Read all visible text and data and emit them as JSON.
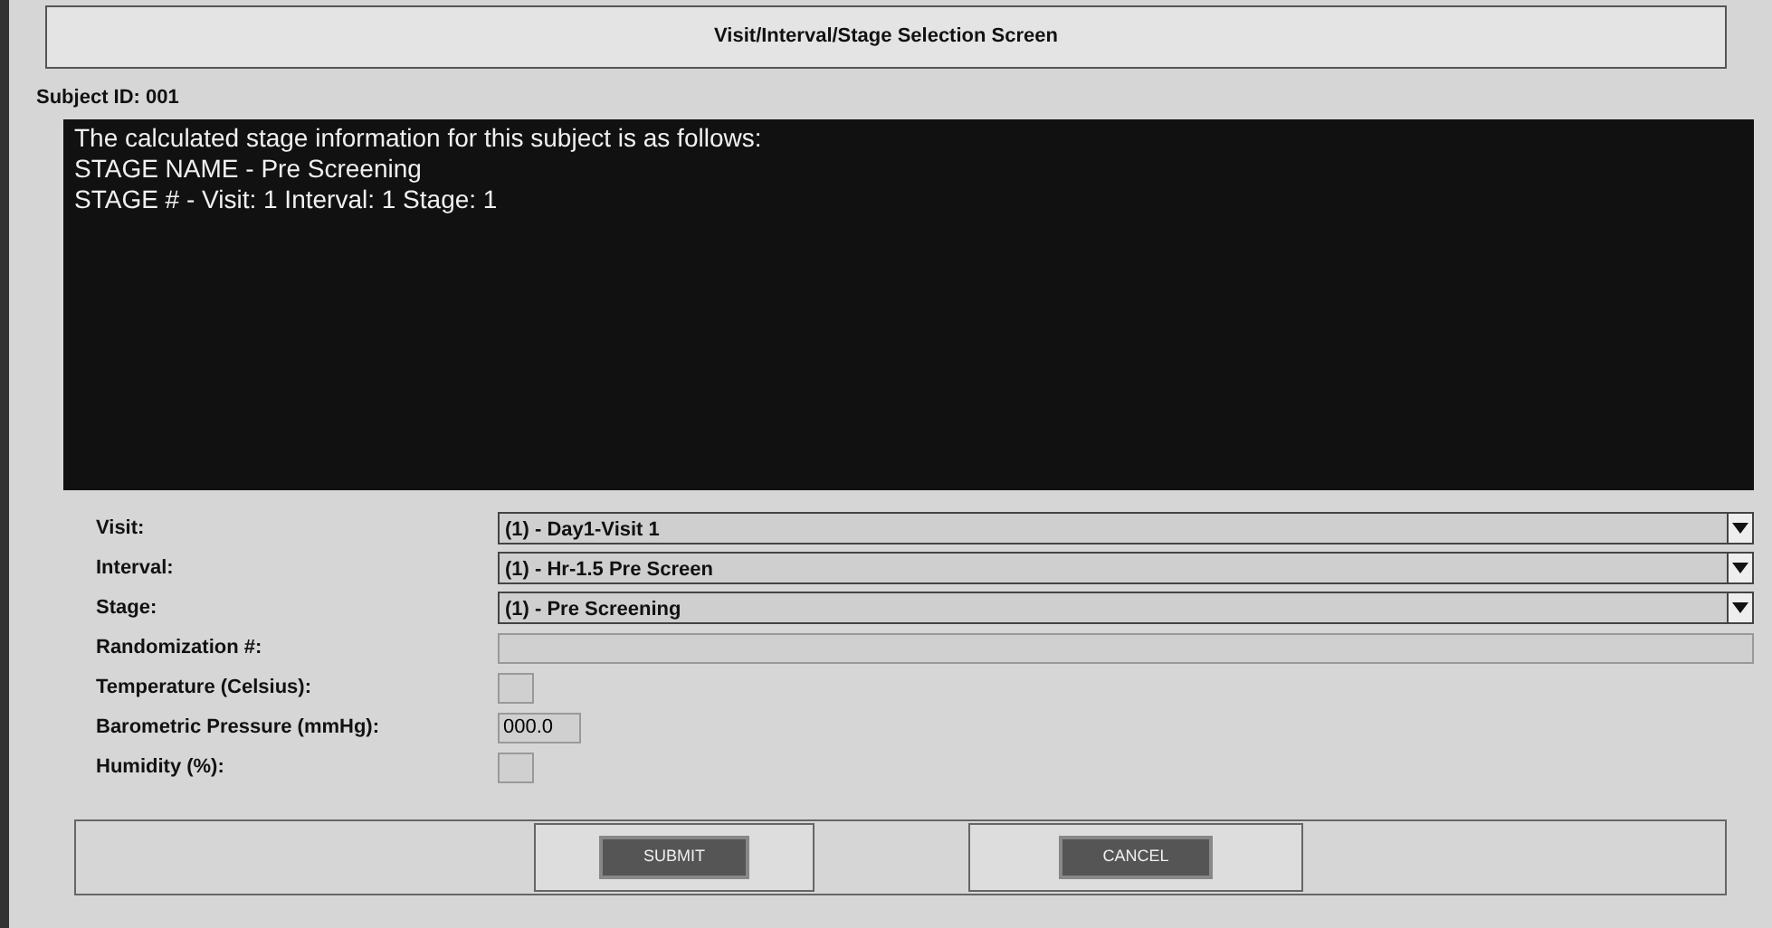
{
  "window": {
    "title": "Visit/Interval/Stage Selection Screen"
  },
  "subject_id": "Subject ID: 001",
  "info_lines": [
    "The calculated stage information for this subject is as follows:",
    "STAGE NAME - Pre Screening",
    "STAGE # - Visit: 1  Interval: 1  Stage: 1"
  ],
  "fields": [
    {
      "kind": "dropdown",
      "label": "Visit:",
      "value": "(1) - Day1-Visit 1"
    },
    {
      "kind": "dropdown",
      "label": "Interval:",
      "value": "(1) - Hr-1.5 Pre Screen"
    },
    {
      "kind": "dropdown",
      "label": "Stage:",
      "value": "(1) - Pre Screening"
    },
    {
      "kind": "wide",
      "label": "Randomization #:"
    },
    {
      "kind": "small",
      "label": "Temperature (Celsius):"
    },
    {
      "kind": "medium",
      "label": "Barometric Pressure (mmHg):",
      "value": "000.0"
    },
    {
      "kind": "small",
      "label": "Humidity (%):"
    }
  ],
  "buttons": [
    {
      "label": "SUBMIT",
      "kind": "submit"
    },
    {
      "label": "CANCEL",
      "kind": "cancel"
    }
  ]
}
